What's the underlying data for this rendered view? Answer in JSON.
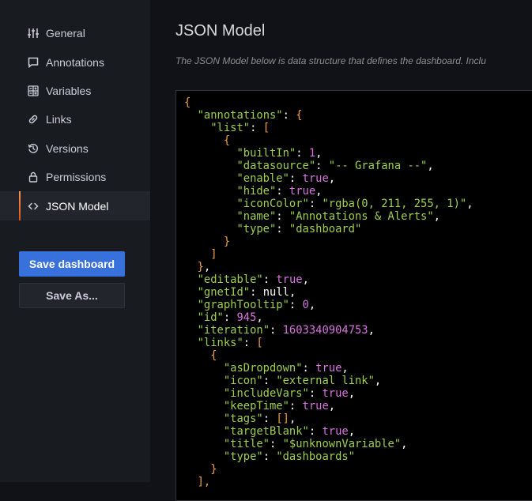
{
  "sidebar": {
    "items": [
      {
        "label": "General",
        "icon": "sliders-icon"
      },
      {
        "label": "Annotations",
        "icon": "comment-icon"
      },
      {
        "label": "Variables",
        "icon": "calculator-icon"
      },
      {
        "label": "Links",
        "icon": "link-icon"
      },
      {
        "label": "Versions",
        "icon": "history-icon"
      },
      {
        "label": "Permissions",
        "icon": "lock-icon"
      },
      {
        "label": "JSON Model",
        "icon": "code-icon",
        "active": true
      }
    ],
    "save_label": "Save dashboard",
    "save_as_label": "Save As..."
  },
  "main": {
    "title": "JSON Model",
    "description": "The JSON Model below is data structure that defines the dashboard. Inclu"
  },
  "colors": {
    "background": "#111217",
    "sidebar": "#181b1f",
    "primary_button": "#3871dc",
    "active_accent": "#f9934e",
    "json_key": "#9ecf4f",
    "json_punct": "#f0a04b",
    "json_number": "#d774de"
  },
  "editor": {
    "lines": [
      [
        {
          "t": "p",
          "v": "{"
        }
      ],
      [
        {
          "t": "c",
          "v": "  "
        },
        {
          "t": "k",
          "v": "\"annotations\""
        },
        {
          "t": "c",
          "v": ": "
        },
        {
          "t": "p",
          "v": "{"
        }
      ],
      [
        {
          "t": "c",
          "v": "    "
        },
        {
          "t": "k",
          "v": "\"list\""
        },
        {
          "t": "c",
          "v": ": "
        },
        {
          "t": "p",
          "v": "["
        }
      ],
      [
        {
          "t": "c",
          "v": "      "
        },
        {
          "t": "p",
          "v": "{"
        }
      ],
      [
        {
          "t": "c",
          "v": "        "
        },
        {
          "t": "k",
          "v": "\"builtIn\""
        },
        {
          "t": "c",
          "v": ": "
        },
        {
          "t": "n",
          "v": "1"
        },
        {
          "t": "c",
          "v": ","
        }
      ],
      [
        {
          "t": "c",
          "v": "        "
        },
        {
          "t": "k",
          "v": "\"datasource\""
        },
        {
          "t": "c",
          "v": ": "
        },
        {
          "t": "s",
          "v": "\"-- Grafana --\""
        },
        {
          "t": "c",
          "v": ","
        }
      ],
      [
        {
          "t": "c",
          "v": "        "
        },
        {
          "t": "k",
          "v": "\"enable\""
        },
        {
          "t": "c",
          "v": ": "
        },
        {
          "t": "n",
          "v": "true"
        },
        {
          "t": "c",
          "v": ","
        }
      ],
      [
        {
          "t": "c",
          "v": "        "
        },
        {
          "t": "k",
          "v": "\"hide\""
        },
        {
          "t": "c",
          "v": ": "
        },
        {
          "t": "n",
          "v": "true"
        },
        {
          "t": "c",
          "v": ","
        }
      ],
      [
        {
          "t": "c",
          "v": "        "
        },
        {
          "t": "k",
          "v": "\"iconColor\""
        },
        {
          "t": "c",
          "v": ": "
        },
        {
          "t": "s",
          "v": "\"rgba(0, 211, 255, 1)\""
        },
        {
          "t": "c",
          "v": ","
        }
      ],
      [
        {
          "t": "c",
          "v": "        "
        },
        {
          "t": "k",
          "v": "\"name\""
        },
        {
          "t": "c",
          "v": ": "
        },
        {
          "t": "s",
          "v": "\"Annotations & Alerts\""
        },
        {
          "t": "c",
          "v": ","
        }
      ],
      [
        {
          "t": "c",
          "v": "        "
        },
        {
          "t": "k",
          "v": "\"type\""
        },
        {
          "t": "c",
          "v": ": "
        },
        {
          "t": "s",
          "v": "\"dashboard\""
        }
      ],
      [
        {
          "t": "c",
          "v": "      "
        },
        {
          "t": "p",
          "v": "}"
        }
      ],
      [
        {
          "t": "c",
          "v": "    "
        },
        {
          "t": "p",
          "v": "]"
        }
      ],
      [
        {
          "t": "c",
          "v": "  "
        },
        {
          "t": "p",
          "v": "}"
        },
        {
          "t": "c",
          "v": ","
        }
      ],
      [
        {
          "t": "c",
          "v": "  "
        },
        {
          "t": "k",
          "v": "\"editable\""
        },
        {
          "t": "c",
          "v": ": "
        },
        {
          "t": "n",
          "v": "true"
        },
        {
          "t": "c",
          "v": ","
        }
      ],
      [
        {
          "t": "c",
          "v": "  "
        },
        {
          "t": "k",
          "v": "\"gnetId\""
        },
        {
          "t": "c",
          "v": ": "
        },
        {
          "t": "c",
          "v": "null"
        },
        {
          "t": "c",
          "v": ","
        }
      ],
      [
        {
          "t": "c",
          "v": "  "
        },
        {
          "t": "k",
          "v": "\"graphTooltip\""
        },
        {
          "t": "c",
          "v": ": "
        },
        {
          "t": "n",
          "v": "0"
        },
        {
          "t": "c",
          "v": ","
        }
      ],
      [
        {
          "t": "c",
          "v": "  "
        },
        {
          "t": "k",
          "v": "\"id\""
        },
        {
          "t": "c",
          "v": ": "
        },
        {
          "t": "n",
          "v": "945"
        },
        {
          "t": "c",
          "v": ","
        }
      ],
      [
        {
          "t": "c",
          "v": "  "
        },
        {
          "t": "k",
          "v": "\"iteration\""
        },
        {
          "t": "c",
          "v": ": "
        },
        {
          "t": "n",
          "v": "1603340904753"
        },
        {
          "t": "c",
          "v": ","
        }
      ],
      [
        {
          "t": "c",
          "v": "  "
        },
        {
          "t": "k",
          "v": "\"links\""
        },
        {
          "t": "c",
          "v": ": "
        },
        {
          "t": "p",
          "v": "["
        }
      ],
      [
        {
          "t": "c",
          "v": "    "
        },
        {
          "t": "p",
          "v": "{"
        }
      ],
      [
        {
          "t": "c",
          "v": "      "
        },
        {
          "t": "k",
          "v": "\"asDropdown\""
        },
        {
          "t": "c",
          "v": ": "
        },
        {
          "t": "n",
          "v": "true"
        },
        {
          "t": "c",
          "v": ","
        }
      ],
      [
        {
          "t": "c",
          "v": "      "
        },
        {
          "t": "k",
          "v": "\"icon\""
        },
        {
          "t": "c",
          "v": ": "
        },
        {
          "t": "s",
          "v": "\"external link\""
        },
        {
          "t": "c",
          "v": ","
        }
      ],
      [
        {
          "t": "c",
          "v": "      "
        },
        {
          "t": "k",
          "v": "\"includeVars\""
        },
        {
          "t": "c",
          "v": ": "
        },
        {
          "t": "n",
          "v": "true"
        },
        {
          "t": "c",
          "v": ","
        }
      ],
      [
        {
          "t": "c",
          "v": "      "
        },
        {
          "t": "k",
          "v": "\"keepTime\""
        },
        {
          "t": "c",
          "v": ": "
        },
        {
          "t": "n",
          "v": "true"
        },
        {
          "t": "c",
          "v": ","
        }
      ],
      [
        {
          "t": "c",
          "v": "      "
        },
        {
          "t": "k",
          "v": "\"tags\""
        },
        {
          "t": "c",
          "v": ": "
        },
        {
          "t": "p",
          "v": "[]"
        },
        {
          "t": "c",
          "v": ","
        }
      ],
      [
        {
          "t": "c",
          "v": "      "
        },
        {
          "t": "k",
          "v": "\"targetBlank\""
        },
        {
          "t": "c",
          "v": ": "
        },
        {
          "t": "n",
          "v": "true"
        },
        {
          "t": "c",
          "v": ","
        }
      ],
      [
        {
          "t": "c",
          "v": "      "
        },
        {
          "t": "k",
          "v": "\"title\""
        },
        {
          "t": "c",
          "v": ": "
        },
        {
          "t": "s",
          "v": "\"$unknownVariable\""
        },
        {
          "t": "c",
          "v": ","
        }
      ],
      [
        {
          "t": "c",
          "v": "      "
        },
        {
          "t": "k",
          "v": "\"type\""
        },
        {
          "t": "c",
          "v": ": "
        },
        {
          "t": "s",
          "v": "\"dashboards\""
        }
      ],
      [
        {
          "t": "c",
          "v": "    "
        },
        {
          "t": "p",
          "v": "}"
        }
      ],
      [
        {
          "t": "c",
          "v": "  "
        },
        {
          "t": "p",
          "v": "],"
        }
      ]
    ]
  }
}
